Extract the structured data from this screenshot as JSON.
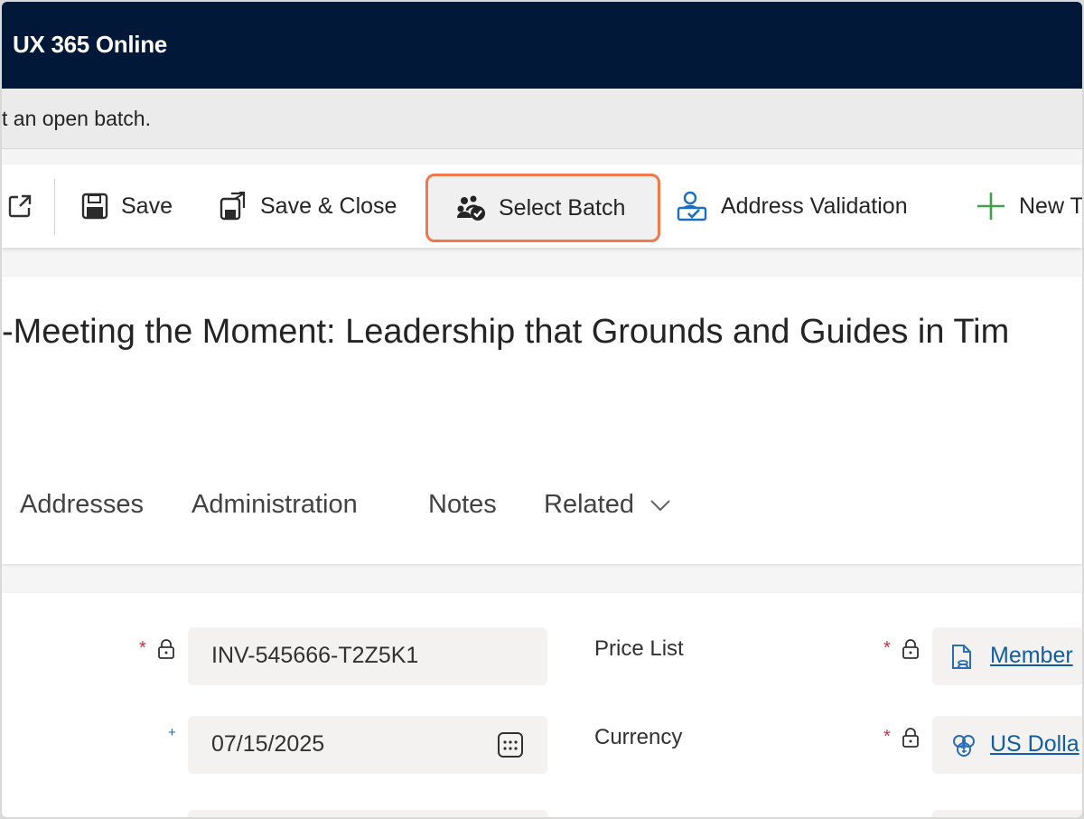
{
  "app": {
    "title": "UX 365 Online"
  },
  "notice": {
    "text": "t an open batch."
  },
  "commands": {
    "save": "Save",
    "save_close": "Save & Close",
    "select_batch": "Select Batch",
    "address_validation": "Address Validation",
    "new": "New T"
  },
  "record": {
    "title": "-Meeting the Moment: Leadership that Grounds and Guides in Tim"
  },
  "tabs": [
    "Addresses",
    "Administration",
    "Notes",
    "Related"
  ],
  "form": {
    "invoice_number": "INV-545666-T2Z5K1",
    "date": "07/15/2025",
    "price_list_label": "Price List",
    "price_list_value": "Member",
    "currency_label": "Currency",
    "currency_value": "US Dolla",
    "required_marker": "*",
    "recommended_marker": "+"
  },
  "colors": {
    "topbar": "#021839",
    "highlight": "#f0784a",
    "link": "#115ea3",
    "required": "#c4314b",
    "accent_blue": "#2566b0",
    "green_plus": "#13a10e"
  }
}
